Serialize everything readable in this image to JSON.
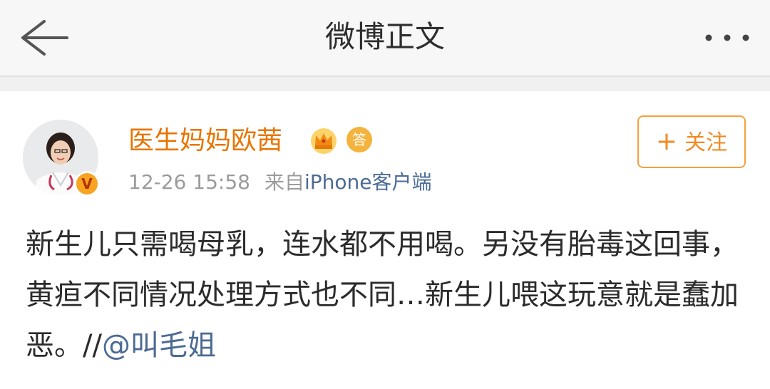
{
  "nav": {
    "title": "微博正文",
    "back_icon": "arrow-left-icon",
    "more_icon": "more-dots-icon"
  },
  "post": {
    "author": "医生妈妈欧茜",
    "verified_badge": "V",
    "badges": [
      "crown-icon",
      "answer-icon"
    ],
    "answer_badge_text": "答",
    "time": "12-26 15:58",
    "source_prefix": "来自",
    "source_device": "iPhone客户端",
    "follow_button": {
      "plus": "+",
      "label": "关注"
    },
    "content": "新生儿只需喝母乳，连水都不用喝。另没有胎毒这回事，黄疸不同情况处理方式也不同…新生儿喂这玩意就是蠢加恶。//",
    "mention": "@叫毛姐"
  },
  "colors": {
    "username": "#e87500",
    "link": "#4c6b94",
    "follow": "#f08a24",
    "navbar_bg": "#f7f7f7"
  }
}
